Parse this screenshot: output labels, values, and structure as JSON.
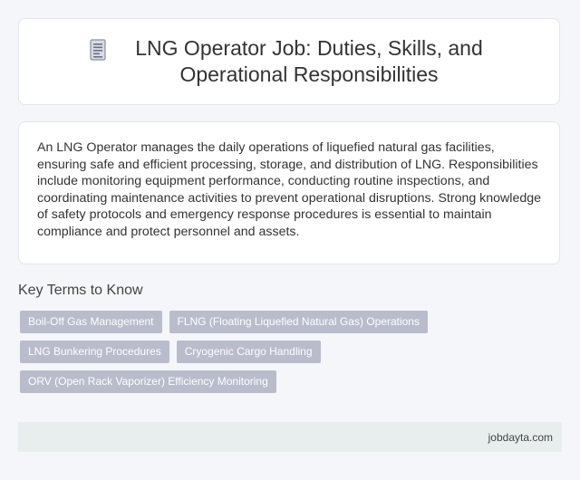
{
  "header": {
    "icon": "document-icon",
    "title": "LNG Operator Job: Duties, Skills, and Operational Responsibilities"
  },
  "description": "An LNG Operator manages the daily operations of liquefied natural gas facilities, ensuring safe and efficient processing, storage, and distribution of LNG. Responsibilities include monitoring equipment performance, conducting routine inspections, and coordinating maintenance activities to prevent operational disruptions. Strong knowledge of safety protocols and emergency response procedures is essential to maintain compliance and protect personnel and assets.",
  "key_terms": {
    "heading": "Key Terms to Know",
    "tags": [
      "Boil-Off Gas Management",
      "FLNG (Floating Liquefied Natural Gas) Operations",
      "LNG Bunkering Procedures",
      "Cryogenic Cargo Handling",
      "ORV (Open Rack Vaporizer) Efficiency Monitoring"
    ]
  },
  "footer": {
    "site": "jobdayta.com"
  },
  "colors": {
    "background": "#f4f6f9",
    "card": "#ffffff",
    "tag": "#b9bccb",
    "footer": "#e8eeee"
  }
}
